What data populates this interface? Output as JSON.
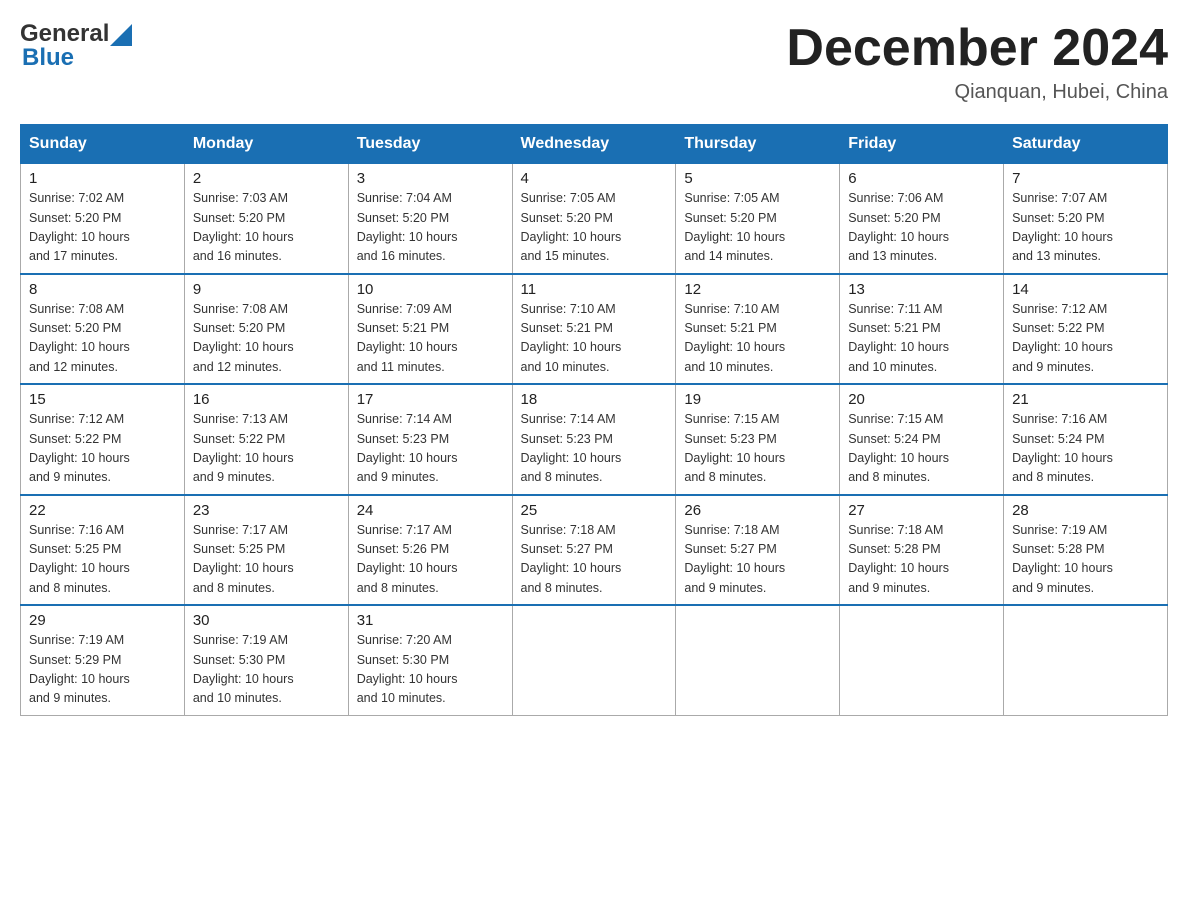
{
  "header": {
    "logo_general": "General",
    "logo_blue": "Blue",
    "month_title": "December 2024",
    "location": "Qianquan, Hubei, China"
  },
  "calendar": {
    "days_of_week": [
      "Sunday",
      "Monday",
      "Tuesday",
      "Wednesday",
      "Thursday",
      "Friday",
      "Saturday"
    ],
    "weeks": [
      [
        {
          "day": "1",
          "sunrise": "7:02 AM",
          "sunset": "5:20 PM",
          "daylight": "10 hours and 17 minutes."
        },
        {
          "day": "2",
          "sunrise": "7:03 AM",
          "sunset": "5:20 PM",
          "daylight": "10 hours and 16 minutes."
        },
        {
          "day": "3",
          "sunrise": "7:04 AM",
          "sunset": "5:20 PM",
          "daylight": "10 hours and 16 minutes."
        },
        {
          "day": "4",
          "sunrise": "7:05 AM",
          "sunset": "5:20 PM",
          "daylight": "10 hours and 15 minutes."
        },
        {
          "day": "5",
          "sunrise": "7:05 AM",
          "sunset": "5:20 PM",
          "daylight": "10 hours and 14 minutes."
        },
        {
          "day": "6",
          "sunrise": "7:06 AM",
          "sunset": "5:20 PM",
          "daylight": "10 hours and 13 minutes."
        },
        {
          "day": "7",
          "sunrise": "7:07 AM",
          "sunset": "5:20 PM",
          "daylight": "10 hours and 13 minutes."
        }
      ],
      [
        {
          "day": "8",
          "sunrise": "7:08 AM",
          "sunset": "5:20 PM",
          "daylight": "10 hours and 12 minutes."
        },
        {
          "day": "9",
          "sunrise": "7:08 AM",
          "sunset": "5:20 PM",
          "daylight": "10 hours and 12 minutes."
        },
        {
          "day": "10",
          "sunrise": "7:09 AM",
          "sunset": "5:21 PM",
          "daylight": "10 hours and 11 minutes."
        },
        {
          "day": "11",
          "sunrise": "7:10 AM",
          "sunset": "5:21 PM",
          "daylight": "10 hours and 10 minutes."
        },
        {
          "day": "12",
          "sunrise": "7:10 AM",
          "sunset": "5:21 PM",
          "daylight": "10 hours and 10 minutes."
        },
        {
          "day": "13",
          "sunrise": "7:11 AM",
          "sunset": "5:21 PM",
          "daylight": "10 hours and 10 minutes."
        },
        {
          "day": "14",
          "sunrise": "7:12 AM",
          "sunset": "5:22 PM",
          "daylight": "10 hours and 9 minutes."
        }
      ],
      [
        {
          "day": "15",
          "sunrise": "7:12 AM",
          "sunset": "5:22 PM",
          "daylight": "10 hours and 9 minutes."
        },
        {
          "day": "16",
          "sunrise": "7:13 AM",
          "sunset": "5:22 PM",
          "daylight": "10 hours and 9 minutes."
        },
        {
          "day": "17",
          "sunrise": "7:14 AM",
          "sunset": "5:23 PM",
          "daylight": "10 hours and 9 minutes."
        },
        {
          "day": "18",
          "sunrise": "7:14 AM",
          "sunset": "5:23 PM",
          "daylight": "10 hours and 8 minutes."
        },
        {
          "day": "19",
          "sunrise": "7:15 AM",
          "sunset": "5:23 PM",
          "daylight": "10 hours and 8 minutes."
        },
        {
          "day": "20",
          "sunrise": "7:15 AM",
          "sunset": "5:24 PM",
          "daylight": "10 hours and 8 minutes."
        },
        {
          "day": "21",
          "sunrise": "7:16 AM",
          "sunset": "5:24 PM",
          "daylight": "10 hours and 8 minutes."
        }
      ],
      [
        {
          "day": "22",
          "sunrise": "7:16 AM",
          "sunset": "5:25 PM",
          "daylight": "10 hours and 8 minutes."
        },
        {
          "day": "23",
          "sunrise": "7:17 AM",
          "sunset": "5:25 PM",
          "daylight": "10 hours and 8 minutes."
        },
        {
          "day": "24",
          "sunrise": "7:17 AM",
          "sunset": "5:26 PM",
          "daylight": "10 hours and 8 minutes."
        },
        {
          "day": "25",
          "sunrise": "7:18 AM",
          "sunset": "5:27 PM",
          "daylight": "10 hours and 8 minutes."
        },
        {
          "day": "26",
          "sunrise": "7:18 AM",
          "sunset": "5:27 PM",
          "daylight": "10 hours and 9 minutes."
        },
        {
          "day": "27",
          "sunrise": "7:18 AM",
          "sunset": "5:28 PM",
          "daylight": "10 hours and 9 minutes."
        },
        {
          "day": "28",
          "sunrise": "7:19 AM",
          "sunset": "5:28 PM",
          "daylight": "10 hours and 9 minutes."
        }
      ],
      [
        {
          "day": "29",
          "sunrise": "7:19 AM",
          "sunset": "5:29 PM",
          "daylight": "10 hours and 9 minutes."
        },
        {
          "day": "30",
          "sunrise": "7:19 AM",
          "sunset": "5:30 PM",
          "daylight": "10 hours and 10 minutes."
        },
        {
          "day": "31",
          "sunrise": "7:20 AM",
          "sunset": "5:30 PM",
          "daylight": "10 hours and 10 minutes."
        },
        null,
        null,
        null,
        null
      ]
    ],
    "sunrise_label": "Sunrise:",
    "sunset_label": "Sunset:",
    "daylight_label": "Daylight:"
  }
}
